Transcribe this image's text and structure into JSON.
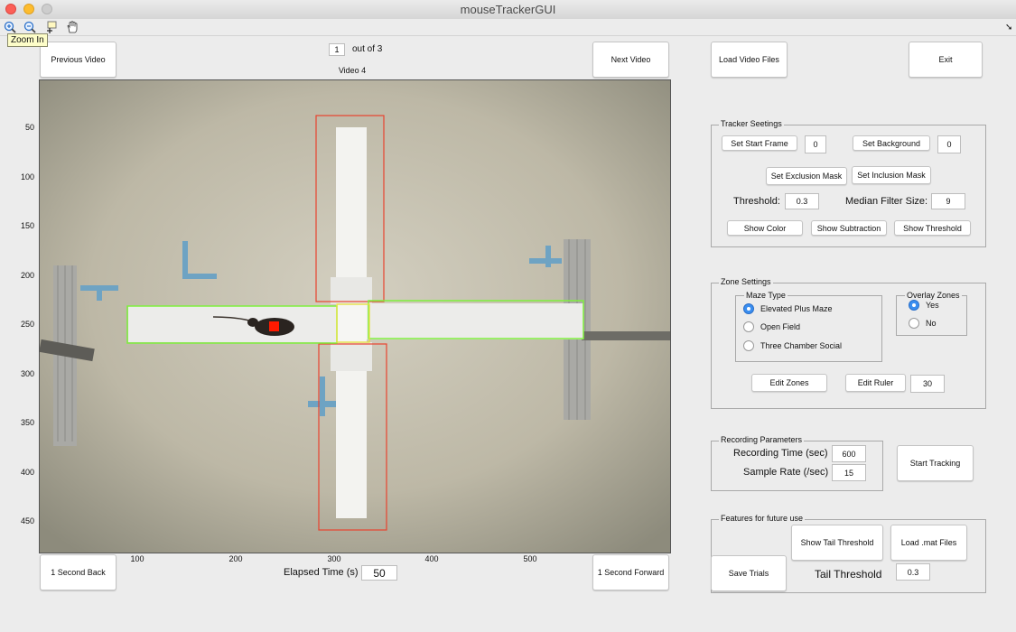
{
  "window": {
    "title": "mouseTrackerGUI"
  },
  "toolbar": {
    "icons": [
      "zoom-in-icon",
      "zoom-out-icon",
      "data-cursor-icon",
      "pan-hand-icon"
    ],
    "tooltip": "Zoom In"
  },
  "nav": {
    "previous_label": "Previous Video",
    "next_label": "Next Video",
    "current_index": "1",
    "out_of_text": "out of 3",
    "video_title": "Video 4",
    "back_label": "1 Second Back",
    "forward_label": "1 Second Forward",
    "elapsed_label": "Elapsed Time (s)",
    "elapsed_value": "50"
  },
  "axes": {
    "y_ticks": [
      "50",
      "100",
      "150",
      "200",
      "250",
      "300",
      "350",
      "400",
      "450"
    ],
    "x_ticks": [
      "100",
      "200",
      "300",
      "400",
      "500"
    ],
    "zone_colors": {
      "closed_arm": "#e8432e",
      "open_arm": "#7ef03c",
      "center": "#e6e23a",
      "mouse_marker": "#ff1a00"
    }
  },
  "top_buttons": {
    "load_label": "Load Video Files",
    "exit_label": "Exit"
  },
  "tracker": {
    "title": "Tracker Seetings",
    "set_start_label": "Set Start Frame",
    "start_value": "0",
    "set_background_label": "Set Background",
    "background_value": "0",
    "exclusion_label": "Set Exclusion Mask",
    "inclusion_label": "Set Inclusion Mask",
    "threshold_label": "Threshold:",
    "threshold_value": "0.3",
    "median_label": "Median Filter Size:",
    "median_value": "9",
    "show_color_label": "Show Color",
    "show_subtraction_label": "Show Subtraction",
    "show_threshold_label": "Show Threshold"
  },
  "zones": {
    "title": "Zone Settings",
    "maze_type_title": "Maze Type",
    "maze_options": [
      "Elevated Plus Maze",
      "Open Field",
      "Three Chamber Social"
    ],
    "maze_selected": "Elevated Plus Maze",
    "overlay_title": "Overlay Zones",
    "overlay_options": [
      "Yes",
      "No"
    ],
    "overlay_selected": "Yes",
    "edit_zones_label": "Edit Zones",
    "edit_ruler_label": "Edit Ruler",
    "ruler_value": "30"
  },
  "recording": {
    "title": "Recording Parameters",
    "time_label": "Recording Time (sec)",
    "time_value": "600",
    "rate_label": "Sample Rate (/sec)",
    "rate_value": "15",
    "start_tracking_label": "Start Tracking"
  },
  "future": {
    "title": "Features for future use",
    "save_trials_label": "Save Trials",
    "show_tail_label": "Show Tail Threshold",
    "load_mat_label": "Load .mat Files",
    "tail_threshold_label": "Tail Threshold",
    "tail_threshold_value": "0.3"
  }
}
